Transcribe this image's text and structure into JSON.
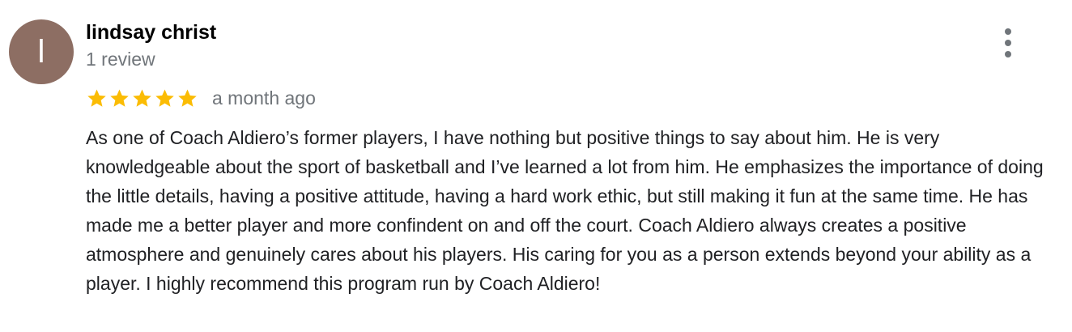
{
  "review": {
    "avatar_initial": "l",
    "avatar_color": "#8d6e63",
    "author_name": "lindsay christ",
    "review_count": "1 review",
    "rating": 5,
    "rating_max": 5,
    "star_color": "#fbbc04",
    "date": "a month ago",
    "text": "As one of Coach Aldiero’s former players, I have nothing but positive things to say about him. He is very knowledgeable about the sport of basketball and I’ve learned a lot from him. He emphasizes the importance of doing the little details, having a positive attitude, having a hard work ethic, but still making it fun at the same time. He has made me a better player and more confindent on and off the court. Coach Aldiero always creates a positive atmosphere and genuinely cares about his players. His caring for you as a person extends beyond your ability as a player. I highly recommend this program run by Coach Aldiero!",
    "more_icon": "more-vert-icon"
  }
}
